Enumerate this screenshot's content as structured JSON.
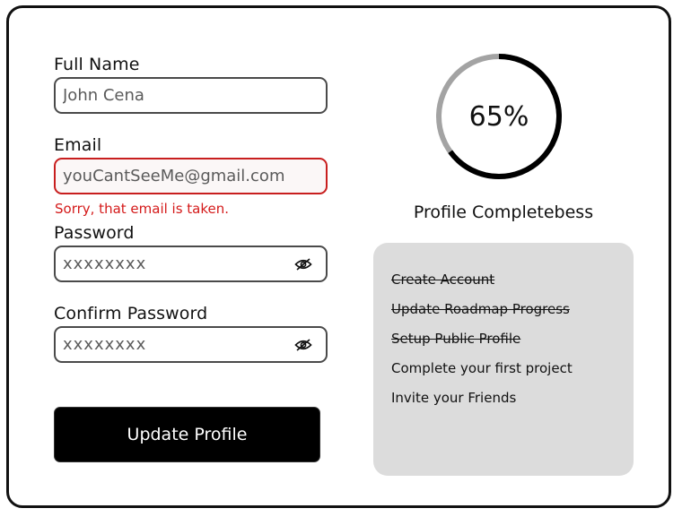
{
  "form": {
    "full_name": {
      "label": "Full Name",
      "value": "John Cena"
    },
    "email": {
      "label": "Email",
      "value": "youCantSeeMe@gmail.com",
      "error": "Sorry, that email is taken."
    },
    "password": {
      "label": "Password",
      "value": "xxxxxxxx",
      "icon": "eye-off-icon"
    },
    "confirm_password": {
      "label": "Confirm Password",
      "value": "xxxxxxxx",
      "icon": "eye-off-icon"
    },
    "submit_label": "Update Profile"
  },
  "profile_completion": {
    "percent": 65,
    "value_text": "65%",
    "title": "Profile Completebess",
    "colors": {
      "done": "#000000",
      "remaining": "#a3a3a3"
    }
  },
  "checklist": {
    "background": "#dcdcdc",
    "items": [
      {
        "label": "Create Account",
        "done": true
      },
      {
        "label": "Update Roadmap Progress",
        "done": true
      },
      {
        "label": "Setup Public Profile",
        "done": true
      },
      {
        "label": "Complete your first project",
        "done": false
      },
      {
        "label": "Invite your Friends",
        "done": false
      }
    ]
  },
  "colors": {
    "error": "#d41a1a",
    "error_border": "#c81e1e",
    "button_bg": "#000000",
    "button_text": "#ffffff"
  }
}
